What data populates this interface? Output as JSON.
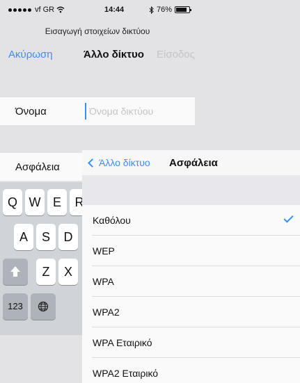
{
  "status_bar": {
    "carrier": "vf GR",
    "time": "14:44",
    "battery": "76%",
    "signal_dots": 5
  },
  "prompt": "Εισαγωγή στοιχείων δικτύου",
  "nav": {
    "cancel_label": "Ακύρωση",
    "title": "Άλλο δίκτυο",
    "join_label": "Είσοδος"
  },
  "form": {
    "name_label": "Όνομα",
    "name_placeholder": "Όνομα δικτύου",
    "name_value": "",
    "security_label": "Ασφάλεια"
  },
  "keyboard": {
    "row1": [
      "Q",
      "W",
      "E",
      "R"
    ],
    "row2": [
      "A",
      "S",
      "D"
    ],
    "row3": [
      "Z",
      "X"
    ],
    "numbers_label": "123"
  },
  "security_sheet": {
    "back_label": "Άλλο δίκτυο",
    "title": "Ασφάλεια",
    "options": [
      {
        "label": "Καθόλου",
        "selected": true
      },
      {
        "label": "WEP",
        "selected": false
      },
      {
        "label": "WPA",
        "selected": false
      },
      {
        "label": "WPA2",
        "selected": false
      },
      {
        "label": "WPA Εταιρικό",
        "selected": false
      },
      {
        "label": "WPA2 Εταιρικό",
        "selected": false
      }
    ]
  },
  "colors": {
    "accent": "#3b8ef5",
    "background": "#e3e3e6",
    "disabled": "#c4c4c8"
  }
}
